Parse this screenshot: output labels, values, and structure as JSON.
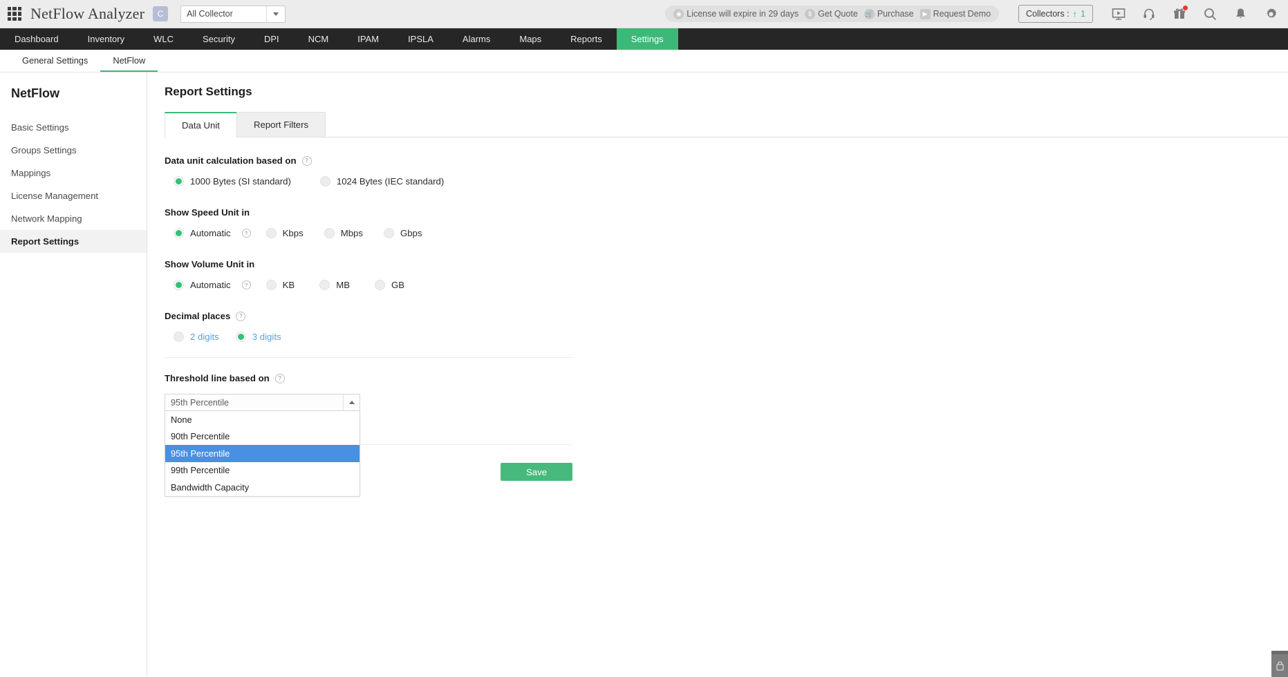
{
  "header": {
    "apps_icon": "grid-apps-icon",
    "brand": "NetFlow Analyzer",
    "c_badge": "C",
    "collector": {
      "value": "All Collector",
      "icon": "chevron-down-icon"
    },
    "license": {
      "expiry": "License will expire in 29 days",
      "expiry_icon": "license-icon",
      "get_quote": "Get Quote",
      "get_quote_icon": "dollar-icon",
      "purchase": "Purchase",
      "purchase_icon": "cart-icon",
      "request_demo": "Request Demo",
      "request_demo_icon": "video-icon"
    },
    "collectors": {
      "label": "Collectors :",
      "arrow": "↑",
      "count": "1"
    },
    "icons": [
      "presentation-icon",
      "headset-icon",
      "gift-icon",
      "search-icon",
      "bell-icon",
      "gear-icon"
    ]
  },
  "mainnav": {
    "items": [
      {
        "label": "Dashboard",
        "active": false
      },
      {
        "label": "Inventory",
        "active": false
      },
      {
        "label": "WLC",
        "active": false
      },
      {
        "label": "Security",
        "active": false
      },
      {
        "label": "DPI",
        "active": false
      },
      {
        "label": "NCM",
        "active": false
      },
      {
        "label": "IPAM",
        "active": false
      },
      {
        "label": "IPSLA",
        "active": false
      },
      {
        "label": "Alarms",
        "active": false
      },
      {
        "label": "Maps",
        "active": false
      },
      {
        "label": "Reports",
        "active": false
      },
      {
        "label": "Settings",
        "active": true
      }
    ]
  },
  "subnav": {
    "items": [
      {
        "label": "General Settings",
        "active": false
      },
      {
        "label": "NetFlow",
        "active": true
      }
    ]
  },
  "sidebar": {
    "title": "NetFlow",
    "items": [
      {
        "label": "Basic Settings",
        "active": false
      },
      {
        "label": "Groups Settings",
        "active": false
      },
      {
        "label": "Mappings",
        "active": false
      },
      {
        "label": "License Management",
        "active": false
      },
      {
        "label": "Network Mapping",
        "active": false
      },
      {
        "label": "Report Settings",
        "active": true
      }
    ]
  },
  "main": {
    "page_title": "Report Settings",
    "tabs": [
      {
        "label": "Data Unit",
        "active": true
      },
      {
        "label": "Report Filters",
        "active": false
      }
    ],
    "sections": {
      "data_unit": {
        "label": "Data unit calculation based on",
        "help": "?",
        "options": [
          {
            "label": "1000 Bytes (SI standard)",
            "selected": true
          },
          {
            "label": "1024 Bytes (IEC standard)",
            "selected": false
          }
        ]
      },
      "speed_unit": {
        "label": "Show Speed Unit in",
        "options": [
          {
            "label": "Automatic",
            "selected": true,
            "help": "?"
          },
          {
            "label": "Kbps",
            "selected": false
          },
          {
            "label": "Mbps",
            "selected": false
          },
          {
            "label": "Gbps",
            "selected": false
          }
        ]
      },
      "volume_unit": {
        "label": "Show Volume Unit in",
        "options": [
          {
            "label": "Automatic",
            "selected": true,
            "help": "?"
          },
          {
            "label": "KB",
            "selected": false
          },
          {
            "label": "MB",
            "selected": false
          },
          {
            "label": "GB",
            "selected": false
          }
        ]
      },
      "decimal_places": {
        "label": "Decimal places",
        "help": "?",
        "options": [
          {
            "label": "2 digits",
            "selected": false
          },
          {
            "label": "3 digits",
            "selected": true
          }
        ]
      },
      "threshold": {
        "label": "Threshold line based on",
        "help": "?",
        "value": "95th Percentile",
        "expanded": true,
        "arrow_icon": "caret-up-icon",
        "options": [
          {
            "label": "None",
            "selected": false
          },
          {
            "label": "90th Percentile",
            "selected": false
          },
          {
            "label": "95th Percentile",
            "selected": true
          },
          {
            "label": "99th Percentile",
            "selected": false
          },
          {
            "label": "Bandwidth Capacity",
            "selected": false
          }
        ]
      }
    },
    "save_label": "Save"
  },
  "corner": {
    "icon": "feedback-icon"
  },
  "colors": {
    "accent_green": "#3cb878",
    "save_green": "#47b97c",
    "select_blue": "#4a90e2",
    "nav_dark": "#262626",
    "link_blue": "#5a9fe0"
  }
}
